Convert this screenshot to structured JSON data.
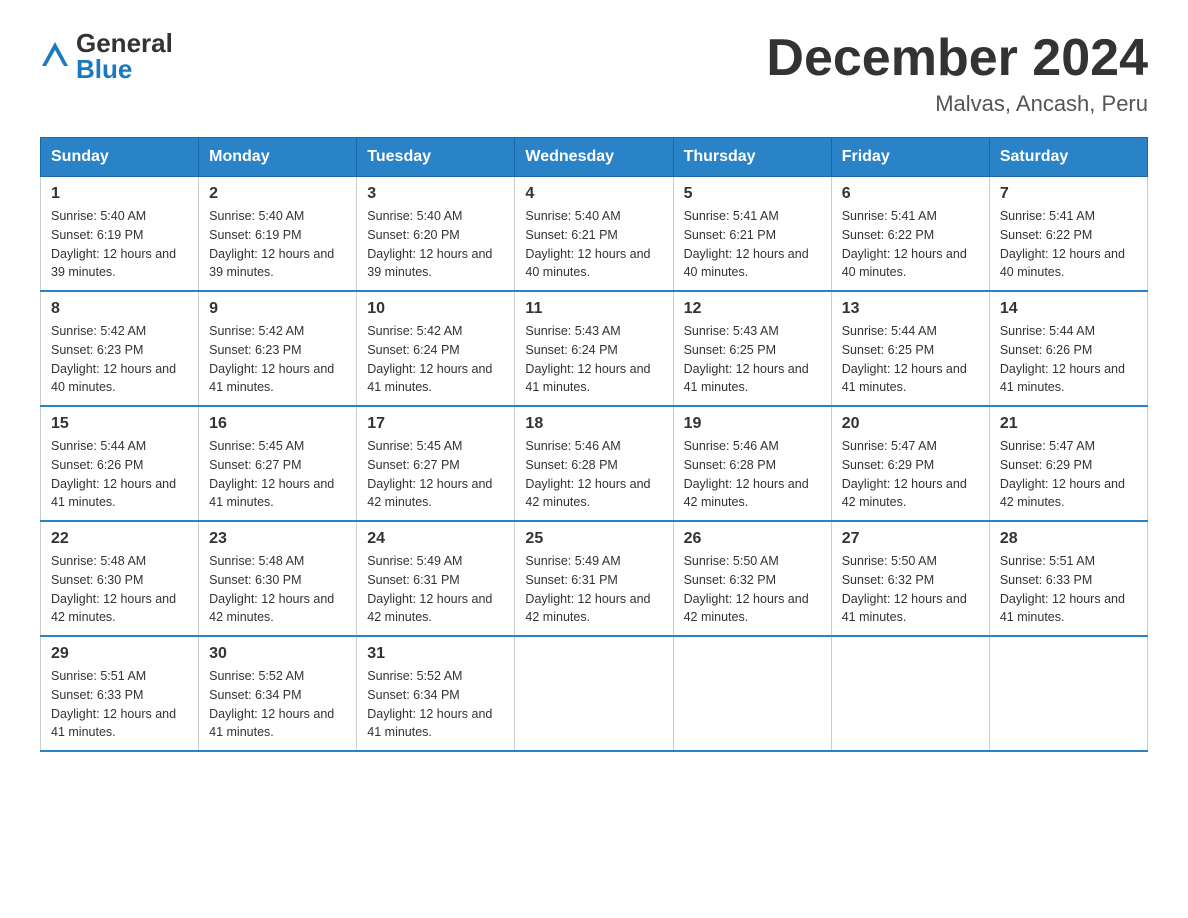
{
  "header": {
    "logo_general": "General",
    "logo_blue": "Blue",
    "month_title": "December 2024",
    "location": "Malvas, Ancash, Peru"
  },
  "weekdays": [
    "Sunday",
    "Monday",
    "Tuesday",
    "Wednesday",
    "Thursday",
    "Friday",
    "Saturday"
  ],
  "weeks": [
    [
      {
        "day": "1",
        "sunrise": "5:40 AM",
        "sunset": "6:19 PM",
        "daylight": "12 hours and 39 minutes."
      },
      {
        "day": "2",
        "sunrise": "5:40 AM",
        "sunset": "6:19 PM",
        "daylight": "12 hours and 39 minutes."
      },
      {
        "day": "3",
        "sunrise": "5:40 AM",
        "sunset": "6:20 PM",
        "daylight": "12 hours and 39 minutes."
      },
      {
        "day": "4",
        "sunrise": "5:40 AM",
        "sunset": "6:21 PM",
        "daylight": "12 hours and 40 minutes."
      },
      {
        "day": "5",
        "sunrise": "5:41 AM",
        "sunset": "6:21 PM",
        "daylight": "12 hours and 40 minutes."
      },
      {
        "day": "6",
        "sunrise": "5:41 AM",
        "sunset": "6:22 PM",
        "daylight": "12 hours and 40 minutes."
      },
      {
        "day": "7",
        "sunrise": "5:41 AM",
        "sunset": "6:22 PM",
        "daylight": "12 hours and 40 minutes."
      }
    ],
    [
      {
        "day": "8",
        "sunrise": "5:42 AM",
        "sunset": "6:23 PM",
        "daylight": "12 hours and 40 minutes."
      },
      {
        "day": "9",
        "sunrise": "5:42 AM",
        "sunset": "6:23 PM",
        "daylight": "12 hours and 41 minutes."
      },
      {
        "day": "10",
        "sunrise": "5:42 AM",
        "sunset": "6:24 PM",
        "daylight": "12 hours and 41 minutes."
      },
      {
        "day": "11",
        "sunrise": "5:43 AM",
        "sunset": "6:24 PM",
        "daylight": "12 hours and 41 minutes."
      },
      {
        "day": "12",
        "sunrise": "5:43 AM",
        "sunset": "6:25 PM",
        "daylight": "12 hours and 41 minutes."
      },
      {
        "day": "13",
        "sunrise": "5:44 AM",
        "sunset": "6:25 PM",
        "daylight": "12 hours and 41 minutes."
      },
      {
        "day": "14",
        "sunrise": "5:44 AM",
        "sunset": "6:26 PM",
        "daylight": "12 hours and 41 minutes."
      }
    ],
    [
      {
        "day": "15",
        "sunrise": "5:44 AM",
        "sunset": "6:26 PM",
        "daylight": "12 hours and 41 minutes."
      },
      {
        "day": "16",
        "sunrise": "5:45 AM",
        "sunset": "6:27 PM",
        "daylight": "12 hours and 41 minutes."
      },
      {
        "day": "17",
        "sunrise": "5:45 AM",
        "sunset": "6:27 PM",
        "daylight": "12 hours and 42 minutes."
      },
      {
        "day": "18",
        "sunrise": "5:46 AM",
        "sunset": "6:28 PM",
        "daylight": "12 hours and 42 minutes."
      },
      {
        "day": "19",
        "sunrise": "5:46 AM",
        "sunset": "6:28 PM",
        "daylight": "12 hours and 42 minutes."
      },
      {
        "day": "20",
        "sunrise": "5:47 AM",
        "sunset": "6:29 PM",
        "daylight": "12 hours and 42 minutes."
      },
      {
        "day": "21",
        "sunrise": "5:47 AM",
        "sunset": "6:29 PM",
        "daylight": "12 hours and 42 minutes."
      }
    ],
    [
      {
        "day": "22",
        "sunrise": "5:48 AM",
        "sunset": "6:30 PM",
        "daylight": "12 hours and 42 minutes."
      },
      {
        "day": "23",
        "sunrise": "5:48 AM",
        "sunset": "6:30 PM",
        "daylight": "12 hours and 42 minutes."
      },
      {
        "day": "24",
        "sunrise": "5:49 AM",
        "sunset": "6:31 PM",
        "daylight": "12 hours and 42 minutes."
      },
      {
        "day": "25",
        "sunrise": "5:49 AM",
        "sunset": "6:31 PM",
        "daylight": "12 hours and 42 minutes."
      },
      {
        "day": "26",
        "sunrise": "5:50 AM",
        "sunset": "6:32 PM",
        "daylight": "12 hours and 42 minutes."
      },
      {
        "day": "27",
        "sunrise": "5:50 AM",
        "sunset": "6:32 PM",
        "daylight": "12 hours and 41 minutes."
      },
      {
        "day": "28",
        "sunrise": "5:51 AM",
        "sunset": "6:33 PM",
        "daylight": "12 hours and 41 minutes."
      }
    ],
    [
      {
        "day": "29",
        "sunrise": "5:51 AM",
        "sunset": "6:33 PM",
        "daylight": "12 hours and 41 minutes."
      },
      {
        "day": "30",
        "sunrise": "5:52 AM",
        "sunset": "6:34 PM",
        "daylight": "12 hours and 41 minutes."
      },
      {
        "day": "31",
        "sunrise": "5:52 AM",
        "sunset": "6:34 PM",
        "daylight": "12 hours and 41 minutes."
      },
      null,
      null,
      null,
      null
    ]
  ]
}
